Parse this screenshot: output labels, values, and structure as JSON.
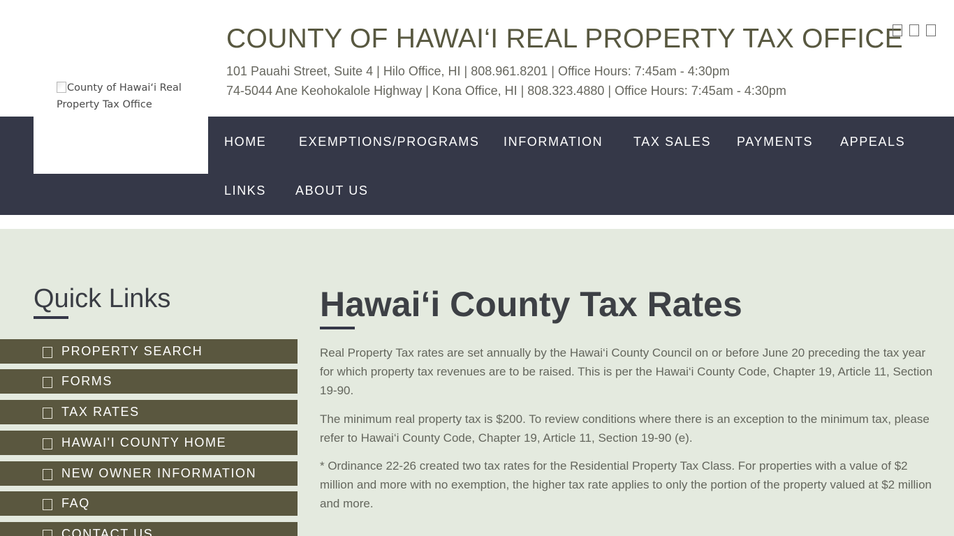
{
  "header": {
    "logo_alt": "County of Hawai‘i Real Property Tax Office",
    "title": "COUNTY OF HAWAI‘I REAL PROPERTY TAX OFFICE",
    "address_hilo": "101 Pauahi Street, Suite 4 | Hilo Office, HI | 808.961.8201 | Office Hours: 7:45am - 4:30pm",
    "address_kona": "74-5044 Ane Keohokalole Highway | Kona Office, HI | 808.323.4880 | Office Hours: 7:45am - 4:30pm",
    "social_icons": [
      "social-icon",
      "social-icon",
      "social-icon"
    ]
  },
  "nav": {
    "items": [
      {
        "label": "HOME"
      },
      {
        "label": "EXEMPTIONS/PROGRAMS"
      },
      {
        "label": "INFORMATION"
      },
      {
        "label": "TAX SALES"
      },
      {
        "label": "PAYMENTS"
      },
      {
        "label": "APPEALS"
      },
      {
        "label": "LINKS"
      },
      {
        "label": "ABOUT US"
      }
    ]
  },
  "sidebar": {
    "title": "Quick Links",
    "items": [
      {
        "label": "PROPERTY SEARCH"
      },
      {
        "label": "FORMS"
      },
      {
        "label": "TAX RATES"
      },
      {
        "label": "HAWAI'I COUNTY HOME"
      },
      {
        "label": "NEW OWNER INFORMATION"
      },
      {
        "label": "FAQ"
      },
      {
        "label": "CONTACT US"
      }
    ]
  },
  "main": {
    "title": "Hawai‘i County Tax Rates",
    "paragraphs": [
      "Real Property Tax rates are set annually by the Hawai‘i County Council on or before June 20 preceding the tax year for which property tax revenues are to be raised. This is per the Hawai‘i County Code, Chapter 19, Article 11, Section 19-90.",
      "The minimum real property tax is $200. To review conditions where there is an exception to the minimum tax, please refer to Hawai‘i County Code, Chapter 19, Article 11, Section 19-90 (e).",
      "* Ordinance 22-26 created two tax rates for the Residential Property Tax Class. For properties with a value of $2 million and more with no exemption, the higher tax rate applies to only the portion of the property valued at $2 million and more."
    ]
  },
  "colors": {
    "nav_bg": "#353848",
    "quicklink_bg": "#5a573f",
    "main_bg": "#e4eadf",
    "title_color": "#585840"
  }
}
